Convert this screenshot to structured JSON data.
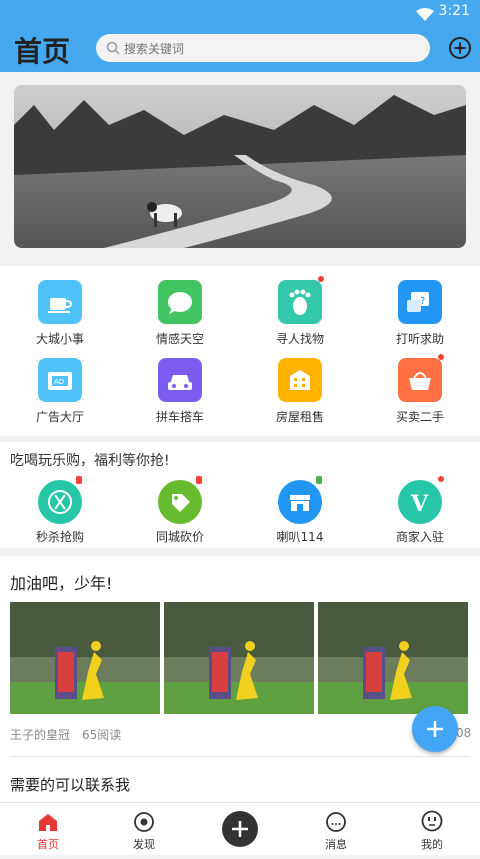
{
  "status_bar": {
    "time": "3:21"
  },
  "header": {
    "title": "首页",
    "search_placeholder": "搜索关键词"
  },
  "grid": [
    {
      "label": "大城小事",
      "color": "#4fc3f7",
      "icon": "coffee-icon"
    },
    {
      "label": "情感天空",
      "color": "#43c463",
      "icon": "chat-bubble-icon"
    },
    {
      "label": "寻人找物",
      "color": "#33c9a8",
      "icon": "footprint-icon"
    },
    {
      "label": "打听求助",
      "color": "#2196f3",
      "icon": "question-chat-icon"
    },
    {
      "label": "广告大厅",
      "color": "#4fc3f7",
      "icon": "ad-ticket-icon"
    },
    {
      "label": "拼车搭车",
      "color": "#7c5cf0",
      "icon": "car-icon"
    },
    {
      "label": "房屋租售",
      "color": "#ffb300",
      "icon": "building-icon"
    },
    {
      "label": "买卖二手",
      "color": "#ff7043",
      "icon": "basket-icon"
    }
  ],
  "promo": {
    "title": "吃喝玩乐购，福利等你抢!",
    "items": [
      {
        "label": "秒杀抢购",
        "color": "#26c6a6",
        "icon": "fork-knife-icon"
      },
      {
        "label": "同城砍价",
        "color": "#66bb2e",
        "icon": "price-tag-icon"
      },
      {
        "label": "喇叭114",
        "color": "#2196f3",
        "icon": "storefront-icon"
      },
      {
        "label": "商家入驻",
        "color": "#26c6a6",
        "icon": "v-badge-icon"
      }
    ]
  },
  "feed": {
    "title": "加油吧，少年!",
    "author": "王子的皇冠",
    "reads": "65阅读",
    "trailing": "08",
    "next_title": "需要的可以联系我"
  },
  "tabbar": [
    {
      "label": "首页"
    },
    {
      "label": "发现"
    },
    {
      "label": ""
    },
    {
      "label": "消息"
    },
    {
      "label": "我的"
    }
  ]
}
